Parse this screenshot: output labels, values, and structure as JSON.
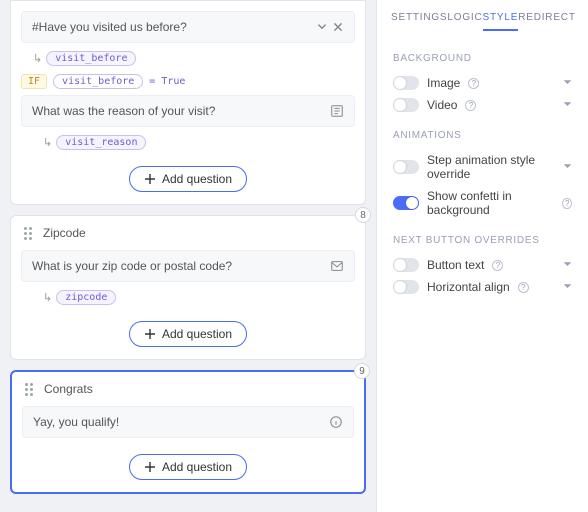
{
  "tabs": {
    "settings": "SETTINGS",
    "logic": "LOGIC",
    "style": "STYLE",
    "redirect": "REDIRECT"
  },
  "sections": {
    "background": {
      "title": "BACKGROUND",
      "image": "Image",
      "video": "Video"
    },
    "animations": {
      "title": "ANIMATIONS",
      "step": "Step animation style override",
      "confetti": "Show confetti in background"
    },
    "next": {
      "title": "NEXT BUTTON OVERRIDES",
      "button_text": "Button text",
      "halign": "Horizontal align"
    }
  },
  "blocks": {
    "b1": {
      "q1": "#Have you visited us before?",
      "var1": "visit_before",
      "if_label": "IF",
      "if_var": "visit_before",
      "if_eq": "= True",
      "q2": "What was the reason of your visit?",
      "var2": "visit_reason"
    },
    "b2": {
      "title": "Zipcode",
      "num": "8",
      "q": "What is your zip code or postal code?",
      "var": "zipcode"
    },
    "b3": {
      "title": "Congrats",
      "num": "9",
      "q": "Yay, you qualify!"
    }
  },
  "add_label": "Add question"
}
